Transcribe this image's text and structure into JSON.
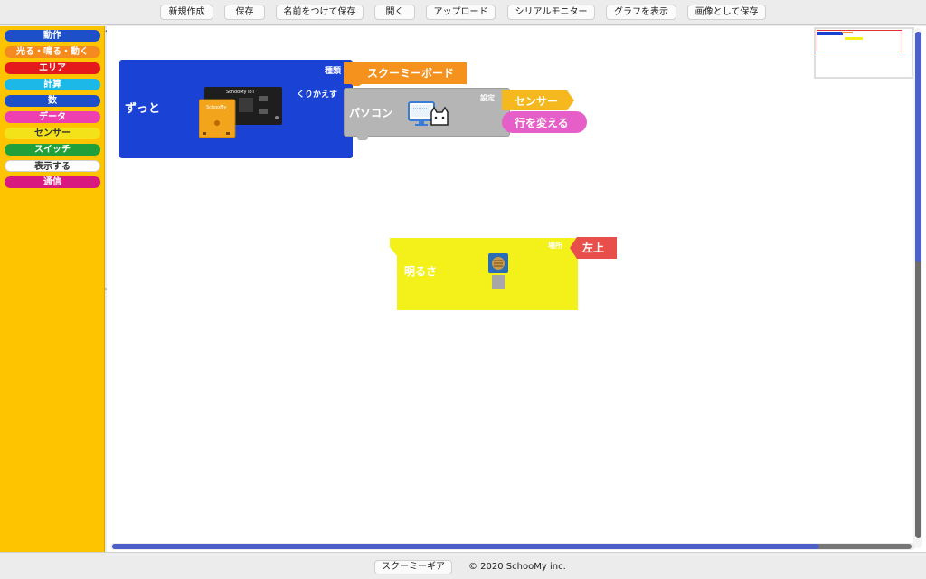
{
  "toolbar": {
    "new": "新規作成",
    "save": "保存",
    "save_as": "名前をつけて保存",
    "open": "開く",
    "upload": "アップロード",
    "serial_monitor": "シリアルモニター",
    "show_graph": "グラフを表示",
    "save_image": "画像として保存"
  },
  "palette": {
    "categories": [
      {
        "label": "動作",
        "color": "#1d50c8"
      },
      {
        "label": "光る・鳴る・動く",
        "color": "#f58a1f"
      },
      {
        "label": "エリア",
        "color": "#e4191b"
      },
      {
        "label": "計算",
        "color": "#1bb8e8"
      },
      {
        "label": "数",
        "color": "#1d50c8"
      },
      {
        "label": "データ",
        "color": "#ee3fb1"
      },
      {
        "label": "センサー",
        "color": "#f3e21a"
      },
      {
        "label": "スイッチ",
        "color": "#20a03a"
      },
      {
        "label": "表示する",
        "color": "#ffffff"
      },
      {
        "label": "通信",
        "color": "#d8197f"
      }
    ]
  },
  "workspace": {
    "forever_block": {
      "label": "ずっと",
      "repeat_label": "くりかえす",
      "kind_label": "種類",
      "color": "#1a43d6"
    },
    "board_block": {
      "label": "スクーミーボード",
      "color": "#f5921e"
    },
    "pc_block": {
      "label": "パソコン",
      "setting_label": "設定",
      "color": "#b5b5b5"
    },
    "sensor_reporter": {
      "label": "センサー",
      "color": "#f5b81e"
    },
    "newline_reporter": {
      "label": "行を変える",
      "color": "#e65fc8"
    },
    "brightness_block": {
      "label": "明るさ",
      "location_label": "場所",
      "color": "#f3f01a"
    },
    "position_reporter": {
      "label": "左上",
      "color": "#e84f4a"
    },
    "board_image_text": {
      "brand": "SchooMy IoT",
      "chip": "SchooMy"
    }
  },
  "footer": {
    "gear_button": "スクーミーギア",
    "copyright": "© 2020 SchooMy inc."
  }
}
